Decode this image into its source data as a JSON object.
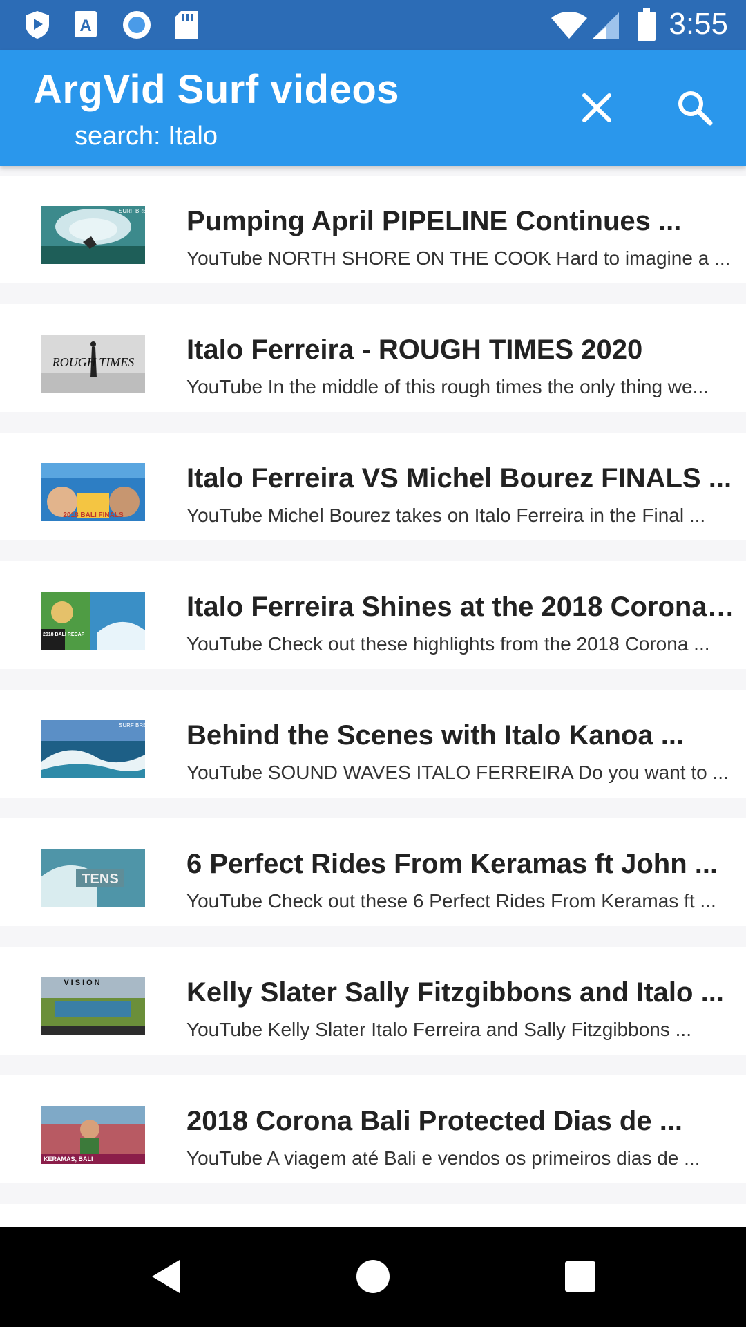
{
  "status_bar": {
    "time": "3:55",
    "left_icons": [
      "play-protect-icon",
      "text-a-icon",
      "circle-record-icon",
      "sd-card-icon"
    ],
    "right_icons": [
      "wifi-icon",
      "signal-icon",
      "battery-icon"
    ]
  },
  "app_bar": {
    "title": "ArgVid Surf videos",
    "subtitle": "search: Italo",
    "actions": [
      "close-icon",
      "search-icon"
    ]
  },
  "videos": [
    {
      "title": "Pumping April PIPELINE Continues ...",
      "description": "YouTube NORTH SHORE ON THE COOK Hard to imagine a ...",
      "thumb_text": "SURF BREAKS"
    },
    {
      "title": "Italo Ferreira - ROUGH TIMES 2020",
      "description": "YouTube In the middle of this rough times the only thing we...",
      "thumb_text": "ROUGH TIMES"
    },
    {
      "title": "Italo Ferreira VS Michel Bourez FINALS ...",
      "description": "YouTube Michel Bourez takes on Italo Ferreira in the Final ...",
      "thumb_text": "2018 BALI FINALS"
    },
    {
      "title": "Italo Ferreira Shines at the 2018 Corona ...",
      "description": "YouTube Check out these highlights from the 2018 Corona ...",
      "thumb_text": "2018 BALI RECAP"
    },
    {
      "title": "Behind the Scenes with Italo Kanoa ...",
      "description": "YouTube SOUND WAVES ITALO FERREIRA Do you want to ...",
      "thumb_text": "SURF BREAKS"
    },
    {
      "title": "6 Perfect Rides From Keramas ft John ...",
      "description": "YouTube Check out these 6 Perfect Rides From Keramas ft ...",
      "thumb_text": "TENS"
    },
    {
      "title": "Kelly Slater Sally Fitzgibbons and Italo ...",
      "description": "YouTube Kelly Slater Italo Ferreira and Sally Fitzgibbons ...",
      "thumb_text": "VISION"
    },
    {
      "title": "2018 Corona Bali Protected  Dias de ...",
      "description": "YouTube A viagem até Bali e vendos os primeiros dias de ...",
      "thumb_text": "KERAMAS, BALI"
    }
  ],
  "nav_bar": {
    "buttons": [
      "back-icon",
      "home-icon",
      "recents-icon"
    ]
  },
  "colors": {
    "status_bar": "#2c6cb6",
    "app_bar": "#2a97ec",
    "list_bg": "#f6f6f8",
    "nav_bar": "#000000"
  }
}
